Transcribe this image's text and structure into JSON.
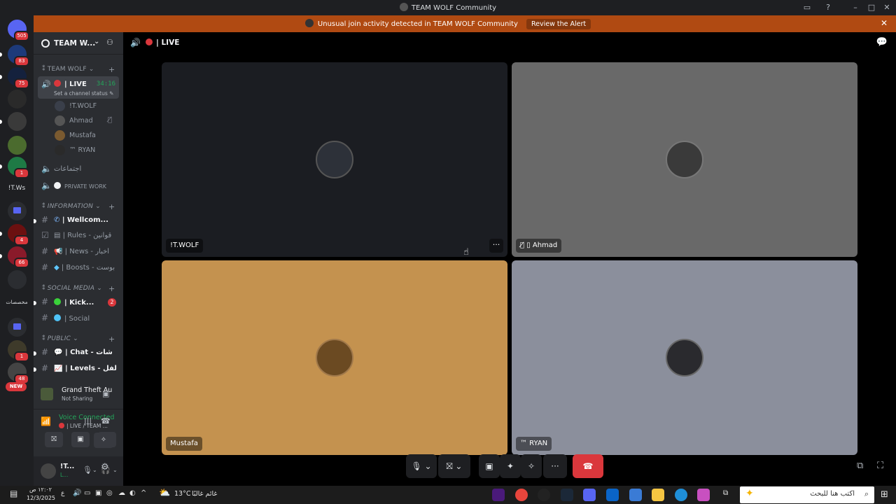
{
  "window": {
    "title": "TEAM WOLF Community",
    "controls": [
      "minimize",
      "maximize",
      "close"
    ]
  },
  "alert": {
    "message": "Unusual join activity detected in TEAM WOLF Community",
    "action": "Review the Alert"
  },
  "guilds": [
    {
      "name": "direct-messages",
      "badge": "505"
    },
    {
      "name": "server-dm",
      "badge": "83"
    },
    {
      "name": "server-2",
      "badge": "75"
    },
    {
      "name": "server-3",
      "badge": ""
    },
    {
      "name": "server-4",
      "badge": ""
    },
    {
      "name": "server-sbt",
      "badge": "1"
    },
    {
      "name": "server-itws",
      "label": "!T.Ws"
    },
    {
      "name": "folder-1",
      "badge": ""
    },
    {
      "name": "server-5",
      "badge": "4"
    },
    {
      "name": "server-6",
      "badge": "66"
    },
    {
      "name": "server-7",
      "badge": ""
    },
    {
      "name": "server-arabic",
      "label": "مخصصات"
    },
    {
      "name": "folder-2",
      "badge": ""
    },
    {
      "name": "server-8",
      "badge": "1"
    },
    {
      "name": "server-9",
      "badge": "48"
    }
  ],
  "guild_new_label": "NEW",
  "server": {
    "name": "TEAM W...",
    "categories": {
      "team_wolf": "TEAM WOLF",
      "information": "INFORMATION",
      "social_media": "SOCIAL MEDIA",
      "public": "PUBLIC"
    },
    "live_channel": {
      "label": "| LIVE",
      "timer": "34:16",
      "status": "Set a channel status"
    },
    "voice_users": [
      {
        "name": "!T.WOLF",
        "muted": false
      },
      {
        "name": "Ahmad",
        "muted": true
      },
      {
        "name": "Mustafa",
        "muted": false
      },
      {
        "name": "™ RYAN",
        "muted": false
      }
    ],
    "channels": {
      "meetings": "اجتماعات",
      "private_work": "PRIVATE WORK",
      "welcome": "| Wellcom...",
      "rules": "| Rules - قوانين",
      "news": "| News - أخبار",
      "boosts": "| Boosts - بوست",
      "kick": "| Kick...",
      "kick_mentions": "2",
      "social": "| Social",
      "chat": "| Chat - شات",
      "levels": "| Levels - لفل"
    }
  },
  "activity": {
    "title": "Grand Theft Auto V...",
    "subtitle": "Not Sharing"
  },
  "voice_panel": {
    "status": "Voice Connected",
    "channel": "| LIVE / TEAM ..."
  },
  "user": {
    "name": "!T...",
    "status": "L..."
  },
  "stage": {
    "channel_label": "| LIVE",
    "tiles": [
      {
        "name": "!T.WOLF",
        "bg": "#1b1d22",
        "muted": false
      },
      {
        "name": "Ahmad",
        "bg": "#696969",
        "muted": true
      },
      {
        "name": "Mustafa",
        "bg": "#c4924f",
        "muted": false
      },
      {
        "name": "™ RYAN",
        "bg": "#8b8f9c",
        "muted": false
      }
    ]
  },
  "taskbar": {
    "time": "١٢:٠٢ ص",
    "date": "12/3/2025",
    "weather": "13°C",
    "weather_desc": "غائم غالبًا",
    "search_placeholder": "اكتب هنا للبحث",
    "lang": "ع"
  },
  "colors": {
    "accent_green": "#23a55a",
    "danger_red": "#da373c",
    "alert_orange": "#b04a12"
  }
}
